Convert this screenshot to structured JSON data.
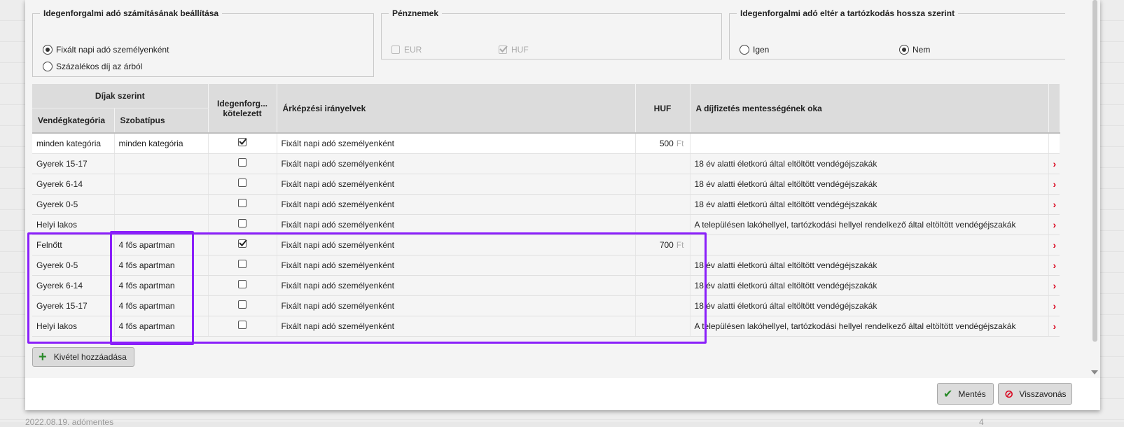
{
  "settings": {
    "calc": {
      "legend": "Idegenforgalmi adó számításának beállítása",
      "options": [
        {
          "label": "Fixált napi adó személyenként",
          "selected": true
        },
        {
          "label": "Százalékos díj az árból",
          "selected": false
        }
      ]
    },
    "currencies": {
      "legend": "Pénznemek",
      "options": [
        {
          "label": "EUR",
          "checked": false
        },
        {
          "label": "HUF",
          "checked": true
        }
      ]
    },
    "duration": {
      "legend": "Idegenforgalmi adó eltér a tartózkodás hossza szerint",
      "options": [
        {
          "label": "Igen",
          "selected": false
        },
        {
          "label": "Nem",
          "selected": true
        }
      ]
    }
  },
  "table": {
    "group_header": "Díjak szerint",
    "headers": {
      "guest_category": "Vendégkategória",
      "room_type": "Szobatípus",
      "obligated": "Idegenforg... kötelezett",
      "pricing": "Árképzési irányelvek",
      "huf": "HUF",
      "reason": "A díjfizetés mentességének oka"
    },
    "currency_suffix": "Ft",
    "rows": [
      {
        "category": "minden kategória",
        "room": "minden kategória",
        "obligated": true,
        "pricing": "Fixált napi adó személyenként",
        "amount": "500",
        "reason": "",
        "action": false
      },
      {
        "category": "Gyerek 15-17",
        "room": "",
        "obligated": false,
        "pricing": "Fixált napi adó személyenként",
        "amount": "",
        "reason": "18 év alatti életkorú által eltöltött vendégéjszakák",
        "action": true
      },
      {
        "category": "Gyerek 6-14",
        "room": "",
        "obligated": false,
        "pricing": "Fixált napi adó személyenként",
        "amount": "",
        "reason": "18 év alatti életkorú által eltöltött vendégéjszakák",
        "action": true
      },
      {
        "category": "Gyerek 0-5",
        "room": "",
        "obligated": false,
        "pricing": "Fixált napi adó személyenként",
        "amount": "",
        "reason": "18 év alatti életkorú által eltöltött vendégéjszakák",
        "action": true
      },
      {
        "category": "Helyi lakos",
        "room": "",
        "obligated": false,
        "pricing": "Fixált napi adó személyenként",
        "amount": "",
        "reason": "A településen lakóhellyel, tartózkodási hellyel rendelkező által eltöltött vendégéjszakák",
        "action": true
      },
      {
        "category": "Felnőtt",
        "room": "4 fős apartman",
        "obligated": true,
        "pricing": "Fixált napi adó személyenként",
        "amount": "700",
        "reason": "",
        "action": true
      },
      {
        "category": "Gyerek 0-5",
        "room": "4 fős apartman",
        "obligated": false,
        "pricing": "Fixált napi adó személyenként",
        "amount": "",
        "reason": "18 év alatti életkorú által eltöltött vendégéjszakák",
        "action": true
      },
      {
        "category": "Gyerek 6-14",
        "room": "4 fős apartman",
        "obligated": false,
        "pricing": "Fixált napi adó személyenként",
        "amount": "",
        "reason": "18 év alatti életkorú által eltöltött vendégéjszakák",
        "action": true
      },
      {
        "category": "Gyerek 15-17",
        "room": "4 fős apartman",
        "obligated": false,
        "pricing": "Fixált napi adó személyenként",
        "amount": "",
        "reason": "18 év alatti életkorú által eltöltött vendégéjszakák",
        "action": true
      },
      {
        "category": "Helyi lakos",
        "room": "4 fős apartman",
        "obligated": false,
        "pricing": "Fixált napi adó személyenként",
        "amount": "",
        "reason": "A településen lakóhellyel, tartózkodási hellyel rendelkező által eltöltött vendégéjszakák",
        "action": true
      }
    ]
  },
  "buttons": {
    "add_exception": "Kivétel hozzáadása",
    "save": "Mentés",
    "cancel": "Visszavonás"
  },
  "background": {
    "left_text": "2022.08.19.    adómentes",
    "right_text": "4"
  },
  "colors": {
    "highlight": "#8a1ffa",
    "action_chevron": "#d9001b",
    "ok_icon": "#2a8a2a",
    "cancel_icon": "#d9001b"
  }
}
